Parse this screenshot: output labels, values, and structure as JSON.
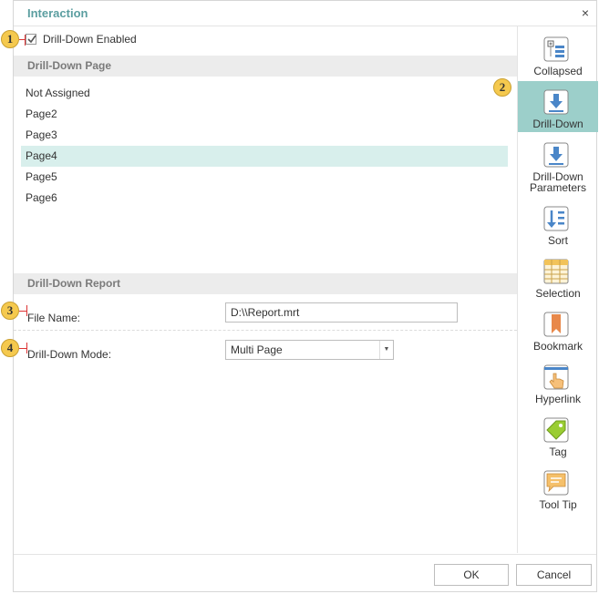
{
  "dialog": {
    "title": "Interaction",
    "close_glyph": "×"
  },
  "drilldown_enabled": {
    "label": "Drill-Down Enabled",
    "checked": true
  },
  "drilldown_page": {
    "section_title": "Drill-Down Page",
    "items": [
      "Not Assigned",
      "Page2",
      "Page3",
      "Page4",
      "Page5",
      "Page6"
    ],
    "selected": "Page4"
  },
  "drilldown_report": {
    "section_title": "Drill-Down Report",
    "file_name_label": "File Name:",
    "file_name_value": "D:\\\\Report.mrt",
    "mode_label": "Drill-Down Mode:",
    "mode_value": "Multi Page"
  },
  "sidebar": {
    "items": [
      {
        "label": "Collapsed",
        "icon": "collapsed-icon"
      },
      {
        "label": "Drill-Down",
        "icon": "drilldown-icon",
        "active": true
      },
      {
        "label": "Drill-Down Parameters",
        "icon": "drilldown-parameters-icon"
      },
      {
        "label": "Sort",
        "icon": "sort-icon"
      },
      {
        "label": "Selection",
        "icon": "selection-icon"
      },
      {
        "label": "Bookmark",
        "icon": "bookmark-icon"
      },
      {
        "label": "Hyperlink",
        "icon": "hyperlink-icon"
      },
      {
        "label": "Tag",
        "icon": "tag-icon"
      },
      {
        "label": "Tool Tip",
        "icon": "tooltip-icon"
      }
    ]
  },
  "footer": {
    "ok_label": "OK",
    "cancel_label": "Cancel"
  },
  "markers": [
    "1",
    "2",
    "3",
    "4"
  ],
  "colors": {
    "accent": "#5b9ea0",
    "selected_row": "#d8efec",
    "active_tab": "#9ccfca",
    "marker": "#f5c94e"
  }
}
